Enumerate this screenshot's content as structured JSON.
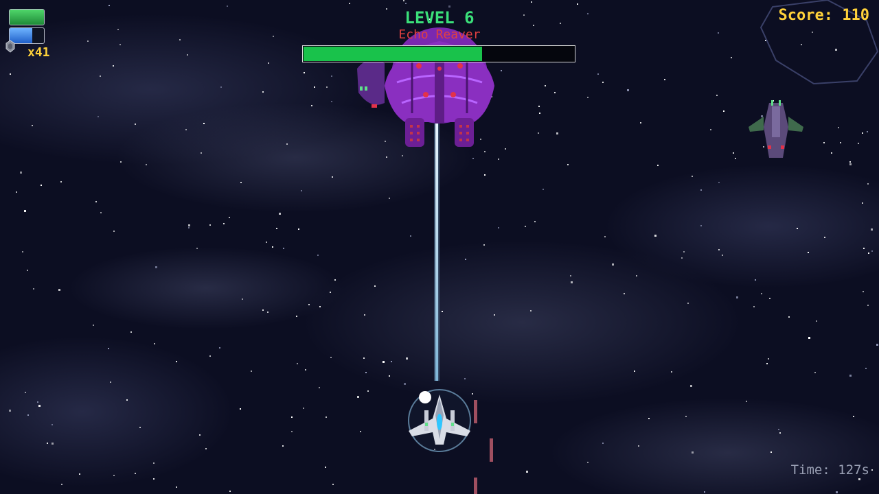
{
  "hud": {
    "level": "LEVEL 6",
    "boss_name": "Echo Reaver",
    "score": "Score: 110",
    "time": "Time: 127s",
    "bomb_count": "x41"
  },
  "bars": {
    "boss_health_fraction": 0.66,
    "player_health_fraction": 1.0,
    "player_shield_fraction": 0.66
  },
  "colors": {
    "level": "#3be07a",
    "boss_name": "#e04040",
    "score": "#ffd23a",
    "boss_bar": "#19c24b",
    "boss_hull": "#8a2fc0",
    "laser": "#bfe4ff"
  },
  "icons": [
    "bomb-icon",
    "shield-bubble-icon"
  ]
}
